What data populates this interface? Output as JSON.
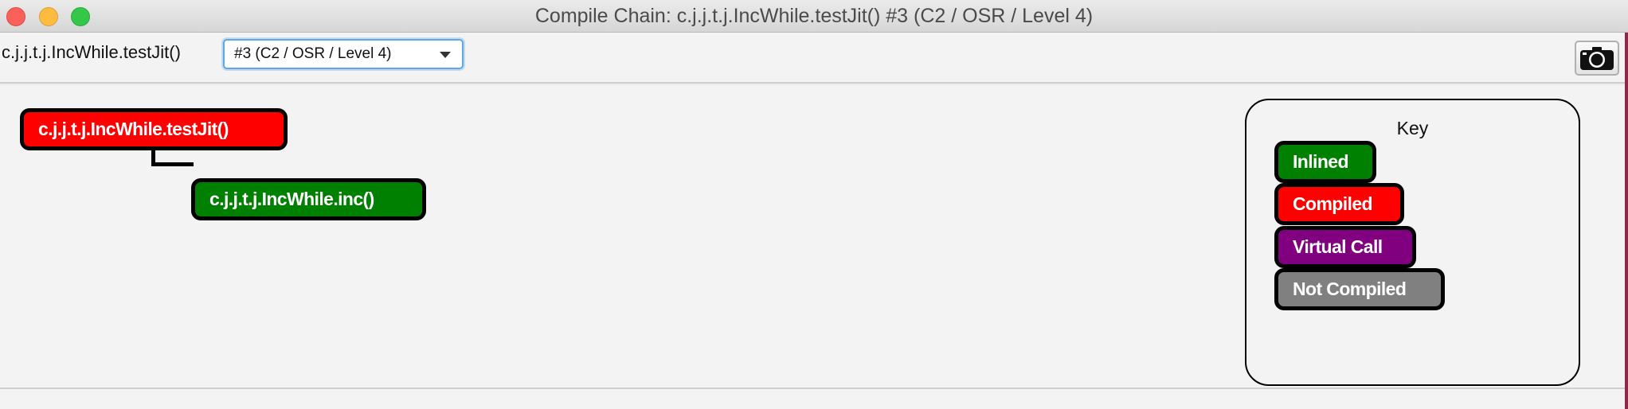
{
  "window": {
    "title": "Compile Chain: c.j.j.t.j.IncWhile.testJit() #3  (C2 / OSR / Level 4)"
  },
  "toolbar": {
    "member_label": "c.j.j.t.j.IncWhile.testJit()",
    "compilation_select": {
      "selected": "#3  (C2 / OSR / Level 4)"
    },
    "snapshot_icon": "camera-icon"
  },
  "chain": {
    "root": {
      "label": "c.j.j.t.j.IncWhile.testJit()",
      "status": "Compiled",
      "color": "#ff0000"
    },
    "children": [
      {
        "label": "c.j.j.t.j.IncWhile.inc()",
        "status": "Inlined",
        "color": "#008000"
      }
    ]
  },
  "key": {
    "title": "Key",
    "items": [
      {
        "label": "Inlined",
        "color": "#008000"
      },
      {
        "label": "Compiled",
        "color": "#ff0000"
      },
      {
        "label": "Virtual Call",
        "color": "#800080"
      },
      {
        "label": "Not Compiled",
        "color": "#808080"
      }
    ]
  }
}
